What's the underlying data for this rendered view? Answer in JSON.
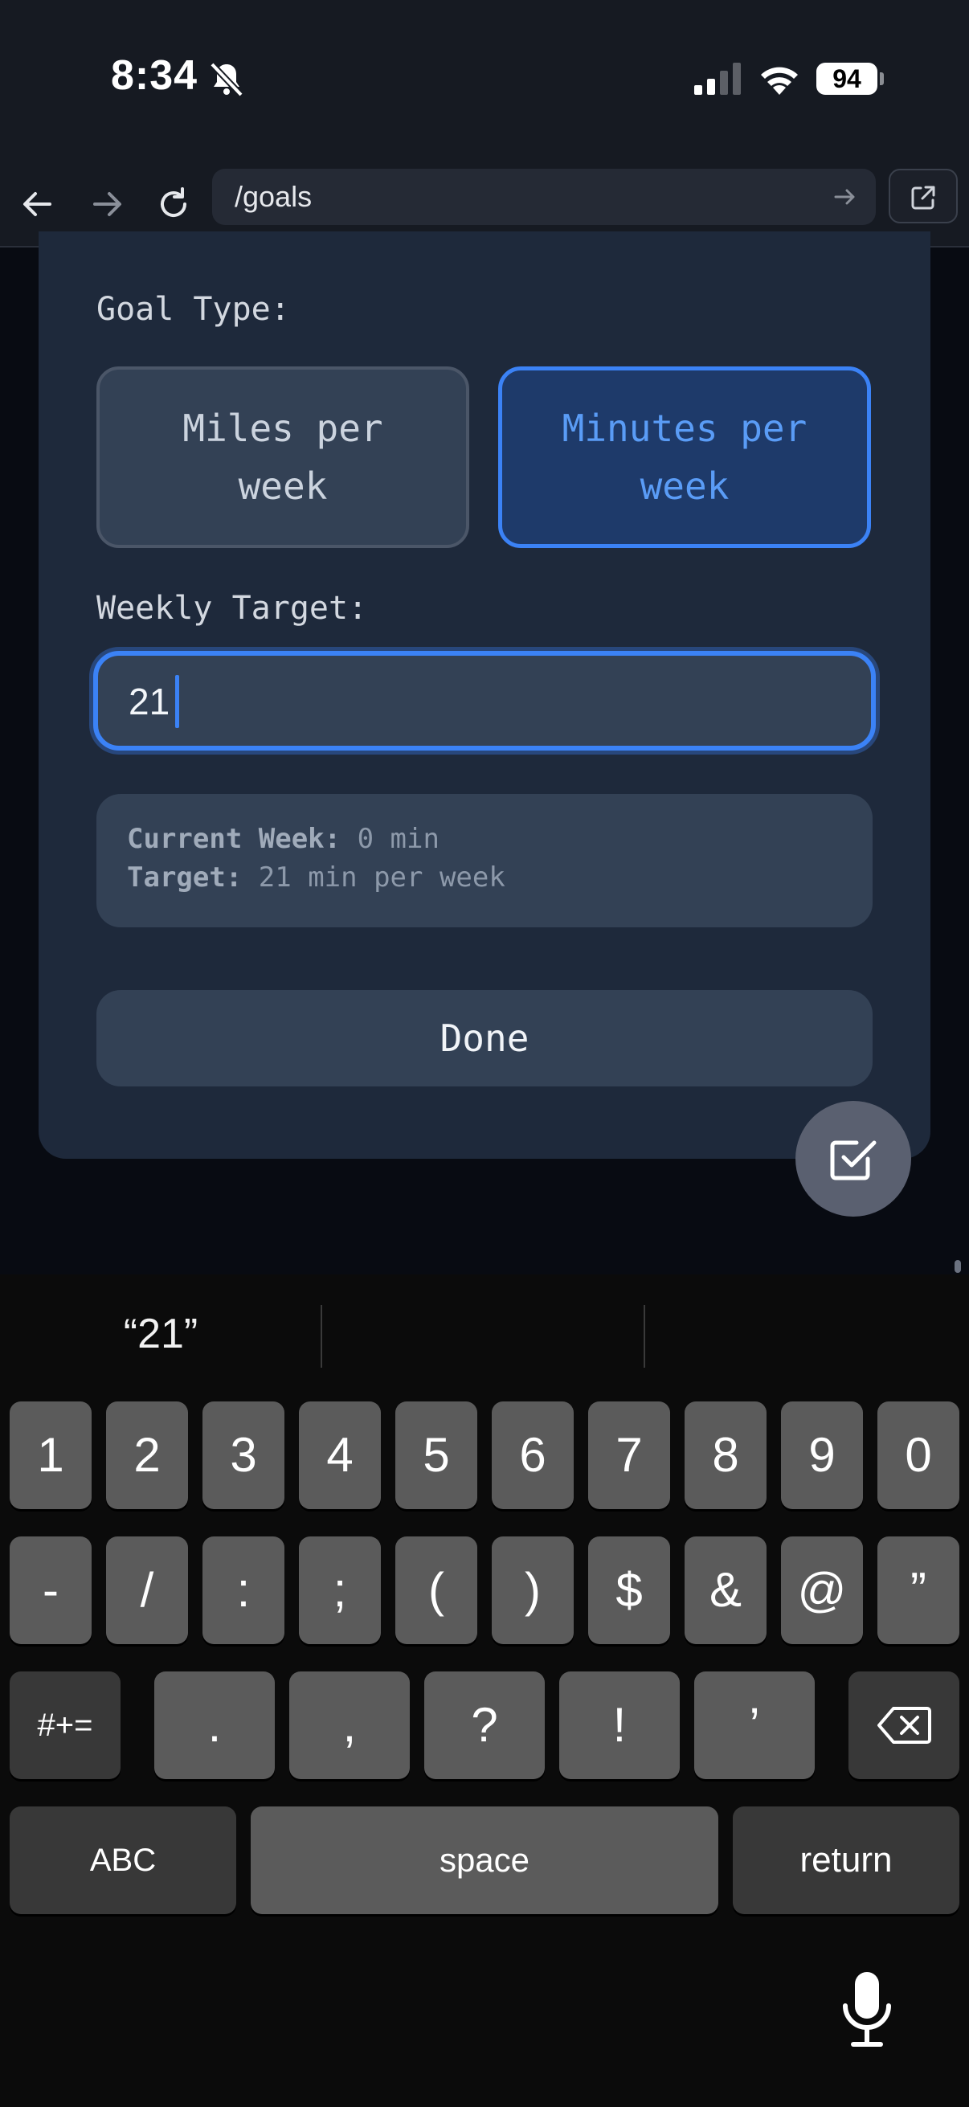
{
  "status_bar": {
    "time": "8:34",
    "battery": "94"
  },
  "browser": {
    "url": "/goals"
  },
  "goal_form": {
    "goal_type_label": "Goal Type:",
    "miles_option": "Miles per week",
    "minutes_option": "Minutes per week",
    "selected_option": "minutes",
    "weekly_target_label": "Weekly Target:",
    "weekly_target_value": "21",
    "summary": {
      "current_week_label": "Current Week:",
      "current_week_value": "0 min",
      "target_label": "Target:",
      "target_value": "21 min per week"
    },
    "done_label": "Done"
  },
  "keyboard": {
    "suggestion": "“21”",
    "row1": [
      "1",
      "2",
      "3",
      "4",
      "5",
      "6",
      "7",
      "8",
      "9",
      "0"
    ],
    "row2": [
      "-",
      "/",
      ":",
      ";",
      "(",
      ")",
      "$",
      "&",
      "@",
      "”"
    ],
    "row3": [
      "#+=",
      ".",
      ",",
      "?",
      "!",
      "’"
    ],
    "abc_label": "ABC",
    "space_label": "space",
    "return_label": "return"
  },
  "colors": {
    "accent": "#3b82f6",
    "card": "#1e293b",
    "panel": "#334155"
  }
}
